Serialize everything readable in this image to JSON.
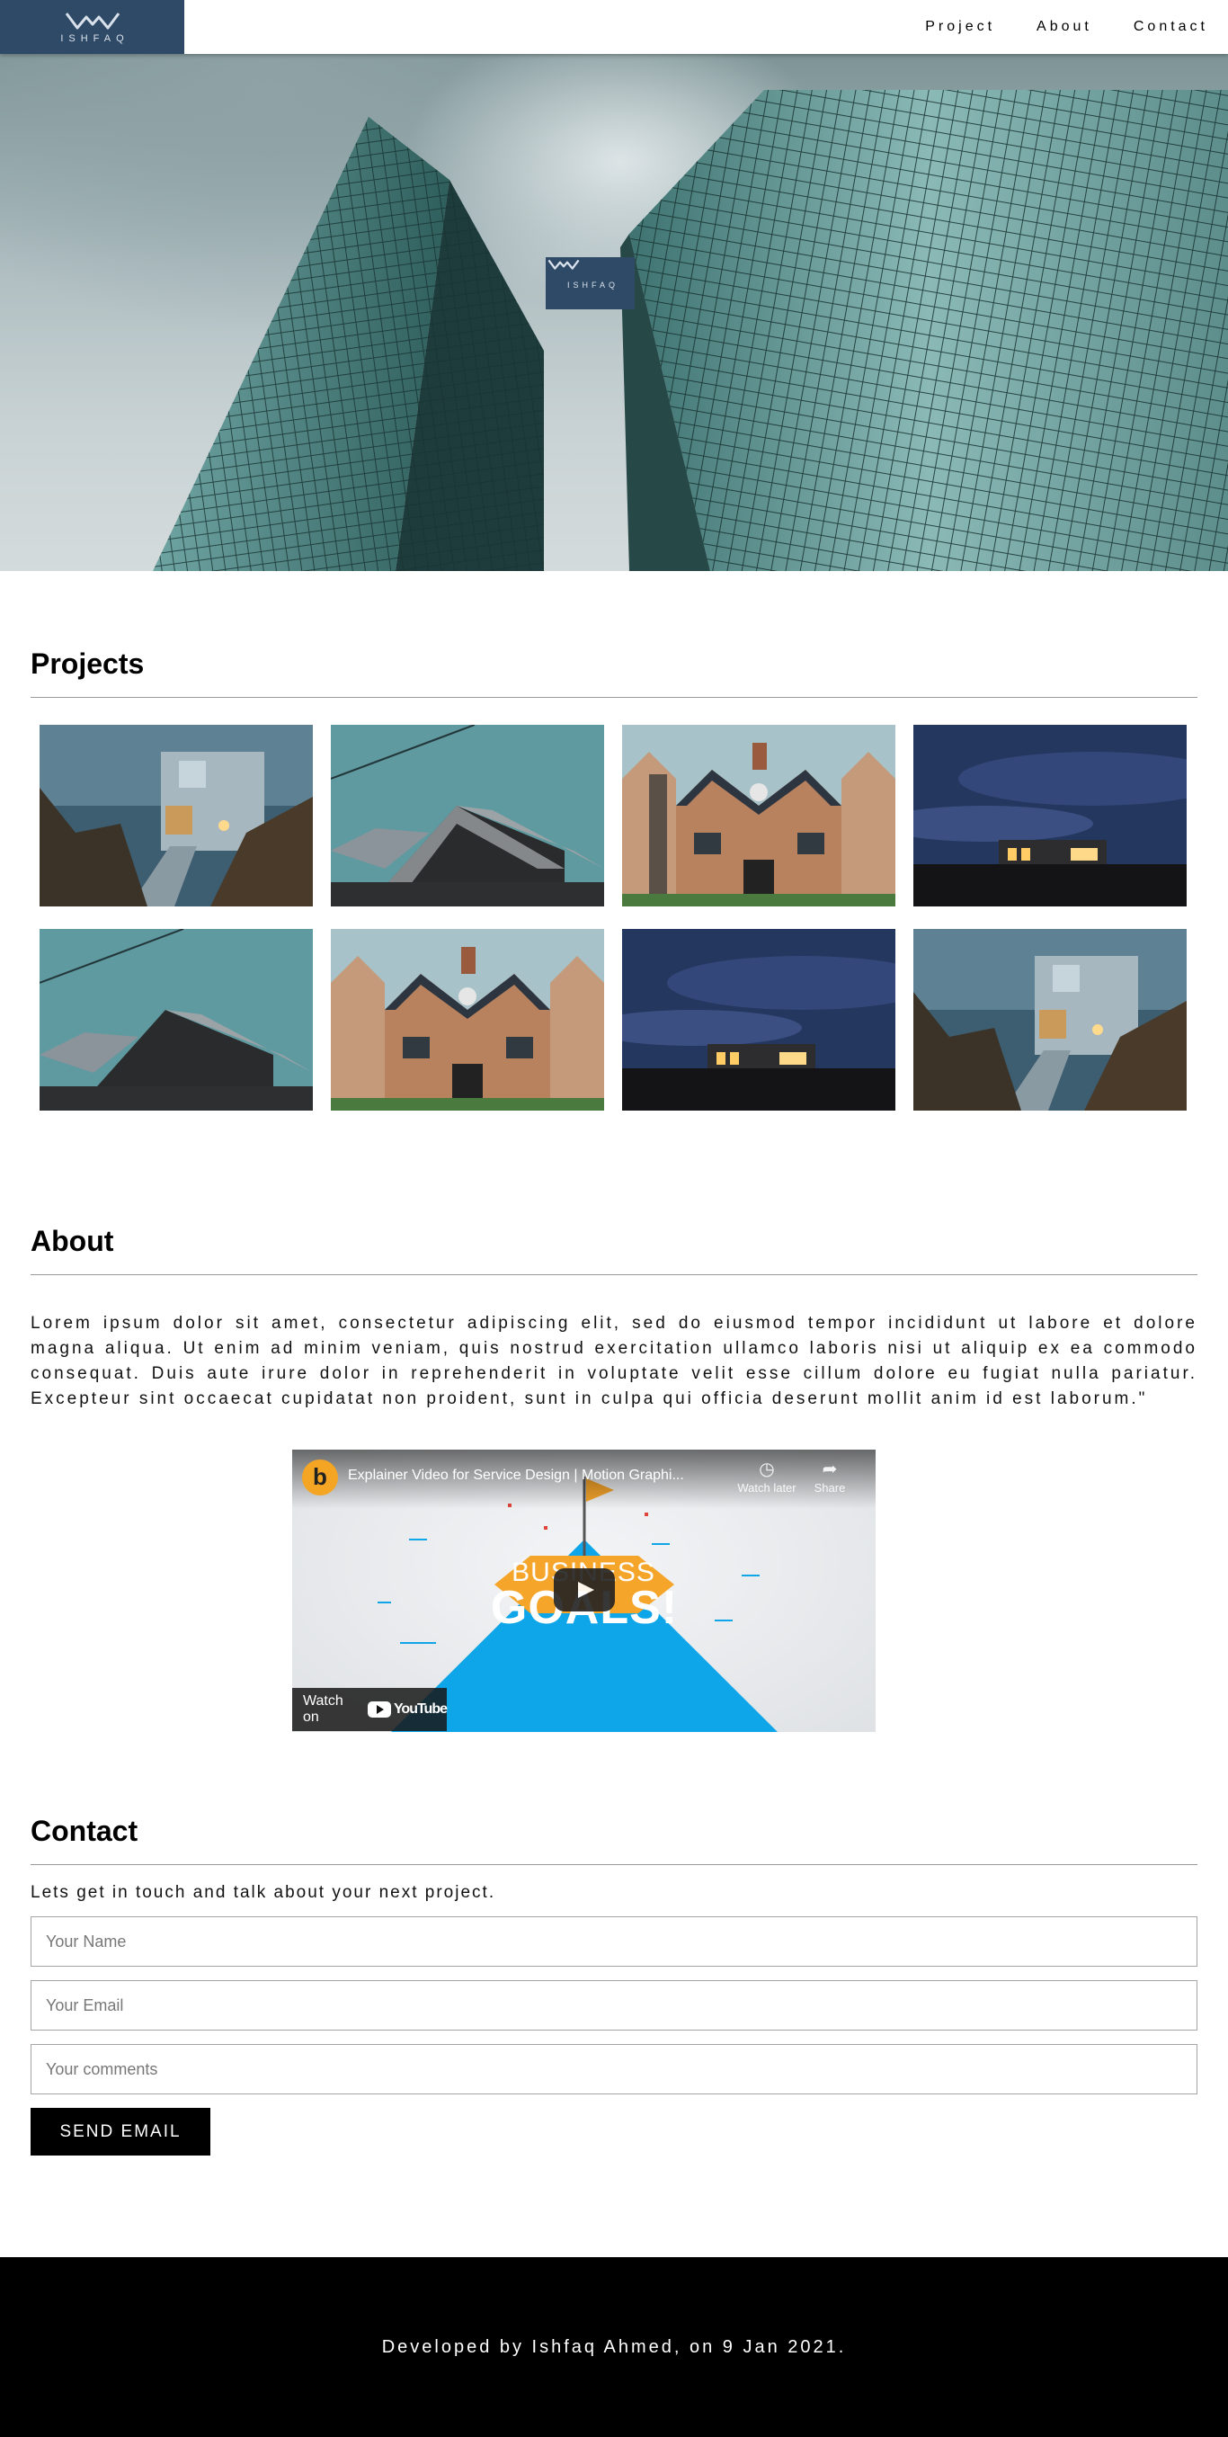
{
  "brand": {
    "name": "ISHFAQ",
    "logo_icon": "ishfaq-logo-icon",
    "color": "#2f4a66"
  },
  "nav": {
    "items": [
      {
        "label": "Project"
      },
      {
        "label": "About"
      },
      {
        "label": "Contact"
      }
    ]
  },
  "hero": {
    "logo_text": "ISHFAQ"
  },
  "projects": {
    "title": "Projects",
    "images": [
      {
        "subject": "modern house with walkway at dusk"
      },
      {
        "subject": "dark timber gabled house"
      },
      {
        "subject": "brick house with round window"
      },
      {
        "subject": "flat house at night under clouds"
      },
      {
        "subject": "dark timber gabled house"
      },
      {
        "subject": "brick house with round window"
      },
      {
        "subject": "flat house at night under clouds"
      },
      {
        "subject": "modern house with walkway at dusk"
      }
    ]
  },
  "about": {
    "title": "About",
    "text": "Lorem ipsum dolor sit amet, consectetur adipiscing elit, sed do eiusmod tempor incididunt ut labore et dolore magna aliqua. Ut enim ad minim veniam, quis nostrud exercitation ullamco laboris nisi ut aliquip ex ea commodo consequat. Duis aute irure dolor in reprehenderit in voluptate velit esse cillum dolore eu fugiat nulla pariatur. Excepteur sint occaecat cupidatat non proident, sunt in culpa qui officia deserunt mollit anim id est laborum.\"",
    "video": {
      "title": "Explainer Video for Service Design | Motion Graphi...",
      "channel_initial": "b",
      "watch_later": "Watch later",
      "share": "Share",
      "watch_on": "Watch on",
      "youtube": "YouTube",
      "thumbnail_line1": "BUSINESS",
      "thumbnail_line2": "GOALS!"
    }
  },
  "contact": {
    "title": "Contact",
    "subtitle": "Lets get in touch and talk about your next project.",
    "name_placeholder": "Your Name",
    "email_placeholder": "Your Email",
    "comments_placeholder": "Your comments",
    "send_label": "SEND EMAIL"
  },
  "footer": {
    "text": "Developed by Ishfaq Ahmed, on 9 Jan 2021."
  }
}
